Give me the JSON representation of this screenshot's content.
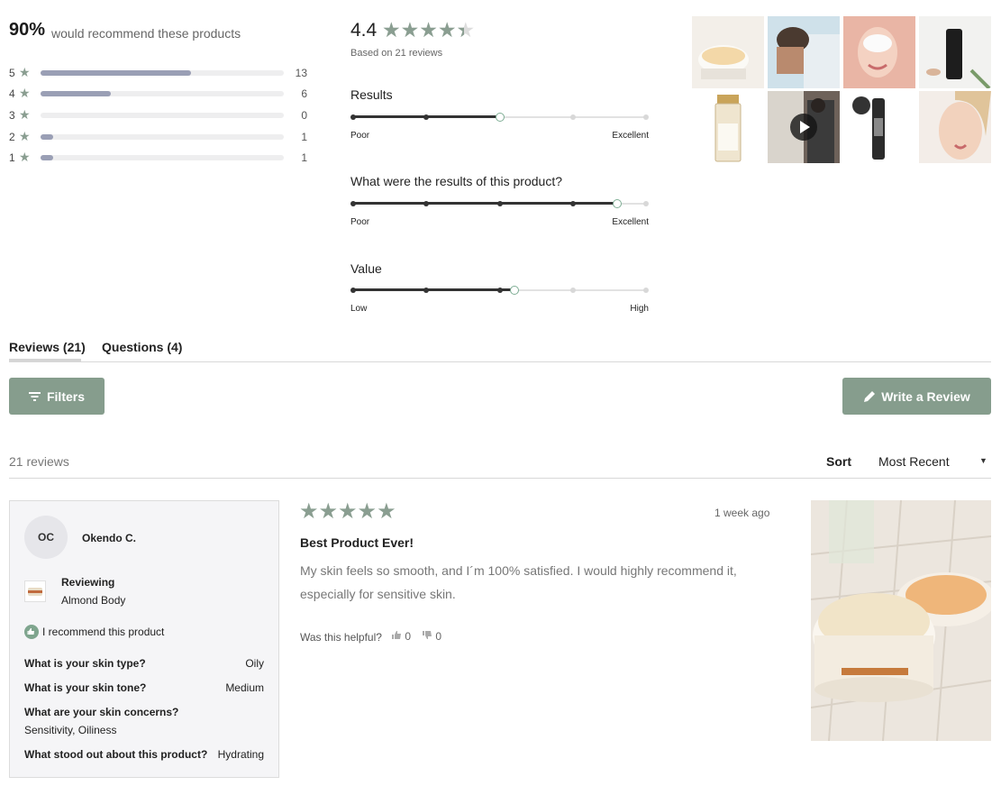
{
  "summary": {
    "recommend_pct": "90%",
    "recommend_text": "would recommend these products",
    "breakdown": [
      {
        "star": "5",
        "count": "13",
        "fraction": 0.62
      },
      {
        "star": "4",
        "count": "6",
        "fraction": 0.29
      },
      {
        "star": "3",
        "count": "0",
        "fraction": 0
      },
      {
        "star": "2",
        "count": "1",
        "fraction": 0.05
      },
      {
        "star": "1",
        "count": "1",
        "fraction": 0.05
      }
    ],
    "average": "4.4",
    "average_stars": "★★★★★",
    "based_on": "Based on 21 reviews"
  },
  "attributes": [
    {
      "title": "Results",
      "low": "Poor",
      "high": "Excellent",
      "value_fraction": 0.5
    },
    {
      "title": "What were the results of this product?",
      "low": "Poor",
      "high": "Excellent",
      "value_fraction": 0.9
    },
    {
      "title": "Value",
      "low": "Low",
      "high": "High",
      "value_fraction": 0.55
    }
  ],
  "tabs": {
    "reviews": "Reviews (21)",
    "questions": "Questions (4)"
  },
  "actions": {
    "filters": "Filters",
    "write_review": "Write a Review"
  },
  "list": {
    "count": "21 reviews",
    "sort_label": "Sort",
    "sort_value": "Most Recent"
  },
  "review": {
    "initials": "OC",
    "name": "Okendo C.",
    "reviewing_label": "Reviewing",
    "product": "Almond Body",
    "recommend": "I recommend this product",
    "attributes": [
      {
        "q": "What is your skin type?",
        "a": "Oily"
      },
      {
        "q": "What is your skin tone?",
        "a": "Medium"
      },
      {
        "q": "What are your skin concerns?",
        "a": "Sensitivity, Oiliness"
      },
      {
        "q": "What stood out about this product?",
        "a": "Hydrating"
      }
    ],
    "stars": "★★★★★",
    "date": "1 week ago",
    "title": "Best Product Ever!",
    "body": "My skin feels so smooth, and I´m 100% satisfied. I would highly recommend it, especially for sensitive skin.",
    "helpful_label": "Was this helpful?",
    "upvotes": "0",
    "downvotes": "0"
  },
  "colors": {
    "accent": "#869d8d",
    "star": "#8a9e91",
    "bar": "#9a9fb5"
  }
}
